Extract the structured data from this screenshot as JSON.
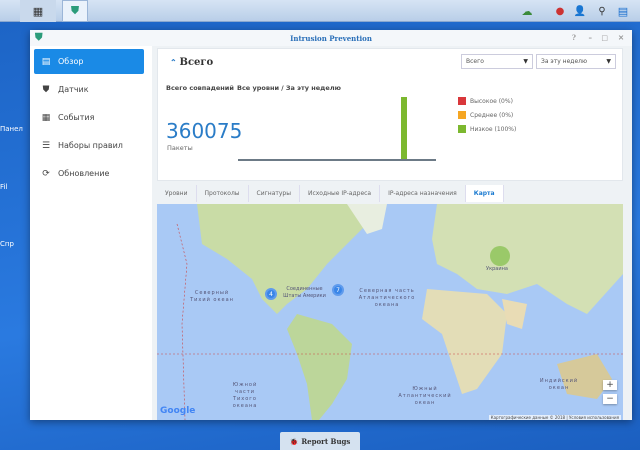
{
  "taskbar": {
    "main_menu_icon": "grid-icon",
    "app_icon": "shield-icon",
    "right_icons": [
      "cloud-sync-icon",
      "notifications-icon",
      "user-icon",
      "search-icon",
      "widgets-icon"
    ]
  },
  "desktop": {
    "icons": [
      "Панел",
      "Fil",
      "Спр"
    ]
  },
  "window": {
    "title": "Intrusion Prevention",
    "controls": [
      "?",
      "–",
      "□",
      "✕"
    ]
  },
  "sidebar": {
    "items": [
      {
        "label": "Обзор",
        "icon": "overview-icon"
      },
      {
        "label": "Датчик",
        "icon": "sensor-icon"
      },
      {
        "label": "События",
        "icon": "events-icon"
      },
      {
        "label": "Наборы правил",
        "icon": "rulesets-icon"
      },
      {
        "label": "Обновление",
        "icon": "update-icon"
      }
    ]
  },
  "summary": {
    "title": "Всего",
    "filter_level": "Всего",
    "filter_period": "За эту неделю",
    "subtitle_1": "Всего совпадений",
    "subtitle_2": "Все уровни / За эту неделю",
    "total": "360075",
    "unit": "Пакеты",
    "legend": [
      {
        "label": "Высокое (0%)",
        "color": "#d9373b"
      },
      {
        "label": "Среднее (0%)",
        "color": "#f5a623"
      },
      {
        "label": "Низкое (100%)",
        "color": "#7cb82f"
      }
    ]
  },
  "chart_data": {
    "type": "bar",
    "series": [
      {
        "name": "Низкое",
        "values": [
          0,
          0,
          0,
          0,
          0,
          0,
          360075
        ]
      }
    ],
    "title": "Всего совпадений",
    "ylim": [
      0,
      360075
    ]
  },
  "tabs": [
    "Уровни",
    "Протоколы",
    "Сигнатуры",
    "Исходные IP-адреса",
    "IP-адреса назначения",
    "Карта"
  ],
  "map": {
    "labels": {
      "n_pacific": "Северный Тихий океан",
      "usa": "Соединенные Штаты Америки",
      "n_atlantic": "Северная часть Атлантического океана",
      "ukraine": "Украина",
      "s_pacific": "Южной части Тихого океана",
      "s_atlantic": "Южный Атлантический океан",
      "indian": "Индийский океан"
    },
    "clusters": [
      {
        "count": "4"
      },
      {
        "count": "7"
      }
    ],
    "zoom_in": "+",
    "zoom_out": "−",
    "logo": "Google",
    "attribution": "Картографические данные © 2018",
    "terms": "Условия использования"
  },
  "report_bugs": "Report Bugs"
}
